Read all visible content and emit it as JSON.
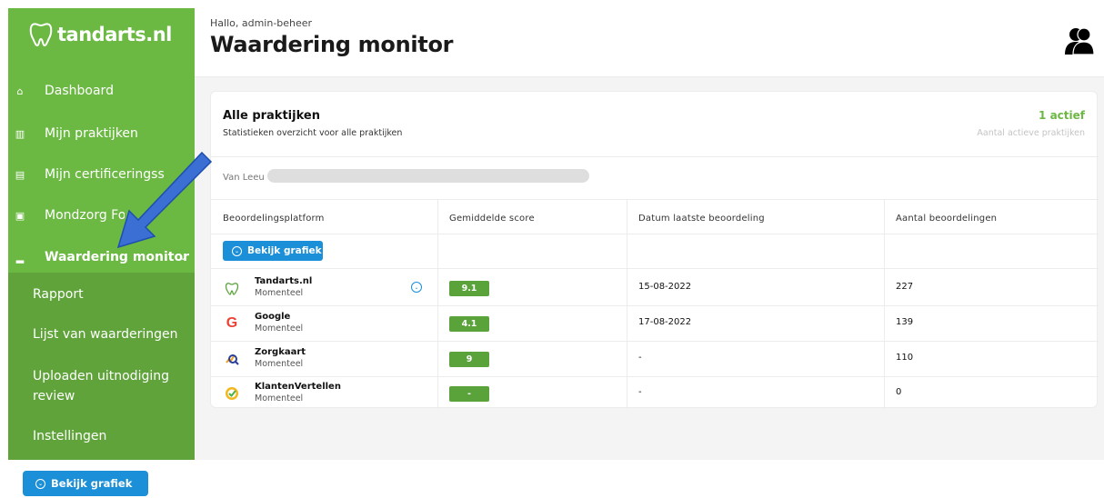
{
  "sidebar": {
    "logo": "tandarts.nl",
    "items": [
      {
        "label": "Dashboard",
        "icon": "home-icon"
      },
      {
        "label": "Mijn praktijken",
        "icon": "building-icon"
      },
      {
        "label": "Mijn certificeringsscans",
        "icon": "document-icon"
      },
      {
        "label": "Mondzorg Forum",
        "icon": "calendar-icon"
      },
      {
        "label": "Waardering monitor",
        "icon": "bar-chart-icon"
      }
    ],
    "submenu": [
      "Rapport",
      "Lijst van waarderingen",
      "Uploaden uitnodiging review",
      "Instellingen"
    ]
  },
  "header": {
    "greeting": "Hallo, admin-beheer",
    "title": "Waardering monitor"
  },
  "card": {
    "title": "Alle praktijken",
    "subtitle": "Statistieken overzicht voor alle praktijken",
    "active_count": "1 actief",
    "active_label": "Aantal actieve praktijken",
    "practice_label": "Van Leeu"
  },
  "table": {
    "columns": [
      "Beoordelingsplatform",
      "Gemiddelde score",
      "Datum laatste beoordeling",
      "Aantal beoordelingen"
    ],
    "chart_button": "Bekijk grafiek",
    "rows": [
      {
        "platform": "Tandarts.nl",
        "sub": "Momenteel",
        "score": "9.1",
        "date": "15-08-2022",
        "count": "227"
      },
      {
        "platform": "Google",
        "sub": "Momenteel",
        "score": "4.1",
        "date": "17-08-2022",
        "count": "139"
      },
      {
        "platform": "Zorgkaart",
        "sub": "Momenteel",
        "score": "9",
        "date": "-",
        "count": "110"
      },
      {
        "platform": "KlantenVertellen",
        "sub": "Momenteel",
        "score": "-",
        "date": "-",
        "count": "0"
      }
    ]
  },
  "bottom_button": "Bekijk grafiek",
  "colors": {
    "brand_green": "#6bb843",
    "button_blue": "#1b8fd8",
    "score_green": "#5aa33b",
    "arrow_blue": "#3b6fd4"
  }
}
